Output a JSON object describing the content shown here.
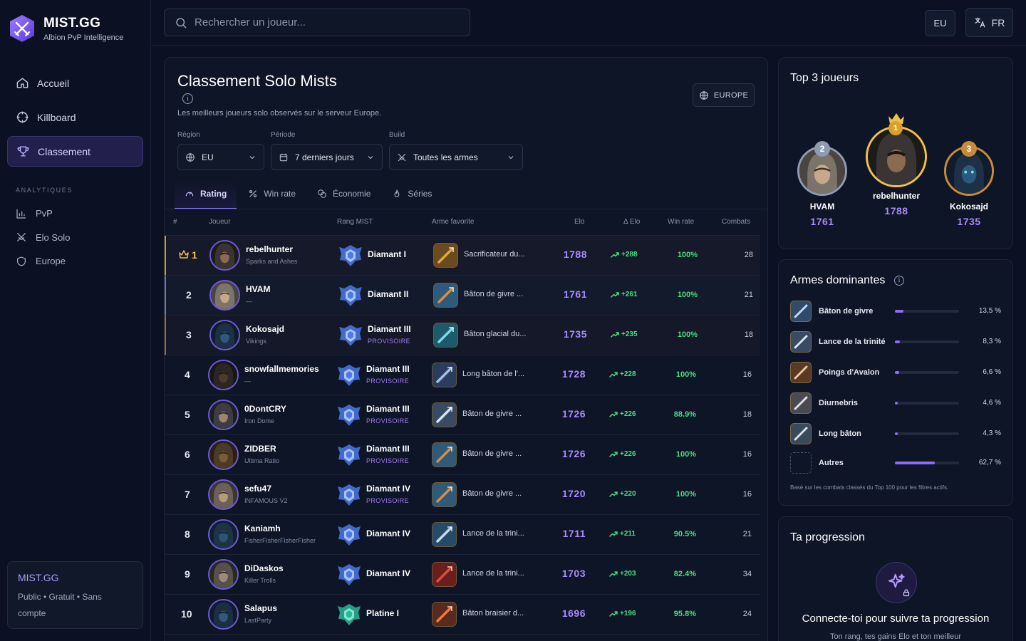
{
  "brand": {
    "title": "MIST.GG",
    "subtitle": "Albion PvP Intelligence"
  },
  "nav": [
    {
      "label": "Accueil",
      "icon": "home-icon"
    },
    {
      "label": "Killboard",
      "icon": "crosshair-icon"
    },
    {
      "label": "Classement",
      "icon": "trophy-icon",
      "active": true
    }
  ],
  "analytics": {
    "label": "ANALYTIQUES",
    "items": [
      {
        "label": "PvP",
        "icon": "bar-chart-icon"
      },
      {
        "label": "Elo Solo",
        "icon": "swords-icon"
      },
      {
        "label": "Europe",
        "icon": "shield-icon"
      }
    ]
  },
  "promo": {
    "title": "MIST.GG",
    "text": "Public • Gratuit • Sans compte"
  },
  "search": {
    "placeholder": "Rechercher un joueur..."
  },
  "header": {
    "region_button": "EU",
    "language_button": "FR"
  },
  "ranking": {
    "title": "Classement Solo Mists",
    "subtitle": "Les meilleurs joueurs solo observés sur le serveur Europe.",
    "server_button": "EUROPE",
    "filters": [
      {
        "label": "Région",
        "value": "EU"
      },
      {
        "label": "Période",
        "value": "7 derniers jours"
      },
      {
        "label": "Build",
        "value": "Toutes les armes"
      }
    ],
    "tabs": [
      "Rating",
      "Win rate",
      "Économie",
      "Séries"
    ],
    "columns": [
      "#",
      "Joueur",
      "Rang MIST",
      "Arme favorite",
      "Elo",
      "Δ Elo",
      "Win rate",
      "Combats"
    ],
    "rows": [
      {
        "rank": "1",
        "name": "rebelhunter",
        "guild": "Sparks and Ashes",
        "tier": "Diamant I",
        "provisional": "",
        "weapon": "Sacrificateur du...",
        "elo": "1788",
        "delta": "+288",
        "winrate": "100%",
        "combats": "28"
      },
      {
        "rank": "2",
        "name": "HVAM",
        "guild": "—",
        "tier": "Diamant II",
        "provisional": "",
        "weapon": "Bâton de givre ...",
        "elo": "1761",
        "delta": "+261",
        "winrate": "100%",
        "combats": "21"
      },
      {
        "rank": "3",
        "name": "Kokosajd",
        "guild": "Vikings",
        "tier": "Diamant III",
        "provisional": "PROVISOIRE",
        "weapon": "Bâton glacial du...",
        "elo": "1735",
        "delta": "+235",
        "winrate": "100%",
        "combats": "18"
      },
      {
        "rank": "4",
        "name": "snowfallmemories",
        "guild": "—",
        "tier": "Diamant III",
        "provisional": "PROVISOIRE",
        "weapon": "Long bâton de l'...",
        "elo": "1728",
        "delta": "+228",
        "winrate": "100%",
        "combats": "16"
      },
      {
        "rank": "5",
        "name": "0DontCRY",
        "guild": "Iron Dome",
        "tier": "Diamant III",
        "provisional": "PROVISOIRE",
        "weapon": "Bâton de givre ...",
        "elo": "1726",
        "delta": "+226",
        "winrate": "88.9%",
        "combats": "18"
      },
      {
        "rank": "6",
        "name": "ZIDBER",
        "guild": "Ultima Ratio",
        "tier": "Diamant III",
        "provisional": "PROVISOIRE",
        "weapon": "Bâton de givre ...",
        "elo": "1726",
        "delta": "+226",
        "winrate": "100%",
        "combats": "16"
      },
      {
        "rank": "7",
        "name": "sefu47",
        "guild": "INFAMOUS V2",
        "tier": "Diamant IV",
        "provisional": "PROVISOIRE",
        "weapon": "Bâton de givre ...",
        "elo": "1720",
        "delta": "+220",
        "winrate": "100%",
        "combats": "16"
      },
      {
        "rank": "8",
        "name": "Kaniamh",
        "guild": "FisherFisherFisherFisher",
        "tier": "Diamant IV",
        "provisional": "",
        "weapon": "Lance de la trini...",
        "elo": "1711",
        "delta": "+211",
        "winrate": "90.5%",
        "combats": "21"
      },
      {
        "rank": "9",
        "name": "DiDaskos",
        "guild": "Killer Trolls",
        "tier": "Diamant IV",
        "provisional": "",
        "weapon": "Lance de la trini...",
        "elo": "1703",
        "delta": "+203",
        "winrate": "82.4%",
        "combats": "34"
      },
      {
        "rank": "10",
        "name": "Salapus",
        "guild": "LastParty",
        "tier": "Platine I",
        "provisional": "",
        "weapon": "Bâton braisier d...",
        "elo": "1696",
        "delta": "+196",
        "winrate": "95.8%",
        "combats": "24"
      }
    ]
  },
  "top3": {
    "title": "Top 3 joueurs",
    "players": [
      {
        "place": "1",
        "name": "rebelhunter",
        "elo": "1788"
      },
      {
        "place": "2",
        "name": "HVAM",
        "elo": "1761"
      },
      {
        "place": "3",
        "name": "Kokosajd",
        "elo": "1735"
      }
    ]
  },
  "weapons": {
    "title": "Armes dominantes",
    "items": [
      {
        "name": "Bâton de givre",
        "pct": "13,5 %",
        "share": 13.5
      },
      {
        "name": "Lance de la trinité",
        "pct": "8,3 %",
        "share": 8.3
      },
      {
        "name": "Poings d'Avalon",
        "pct": "6,6 %",
        "share": 6.6
      },
      {
        "name": "Diurnebris",
        "pct": "4,6 %",
        "share": 4.6
      },
      {
        "name": "Long bâton",
        "pct": "4,3 %",
        "share": 4.3
      },
      {
        "name": "Autres",
        "pct": "62,7 %",
        "share": 62.7
      }
    ],
    "note": "Basé sur les combats classés du Top 100 pour les filtres actifs."
  },
  "progress": {
    "title": "Ta progression",
    "cta": "Connecte-toi pour suivre ta progression",
    "desc": "Ton rang, tes gains Elo et ton meilleur"
  },
  "colors": {
    "accent": "#8d6bf5",
    "positive": "#4ade80",
    "gold": "#f1c04a",
    "background": "#0b1122"
  }
}
